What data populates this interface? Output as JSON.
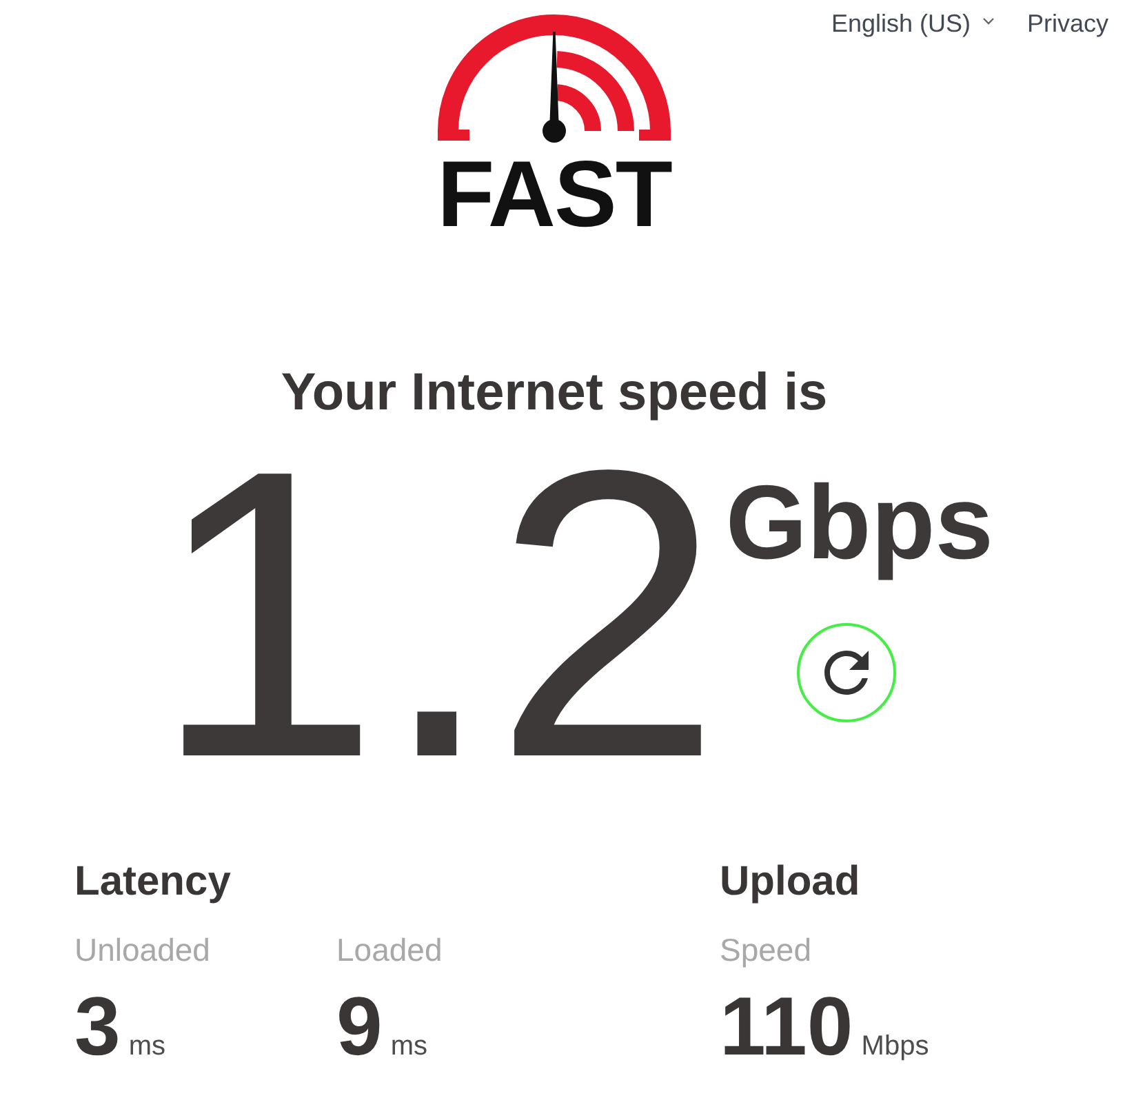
{
  "header": {
    "language_selector": {
      "label": "English (US)"
    },
    "privacy_link": {
      "label": "Privacy"
    }
  },
  "logo": {
    "wordmark": "FAST"
  },
  "speed": {
    "heading": "Your Internet speed is",
    "value": "1.2",
    "unit": "Gbps"
  },
  "stats": [
    {
      "title": "Latency",
      "metrics": [
        {
          "label": "Unloaded",
          "value": "3",
          "unit": "ms"
        },
        {
          "label": "Loaded",
          "value": "9",
          "unit": "ms"
        }
      ]
    },
    {
      "title": "Upload",
      "metrics": [
        {
          "label": "Speed",
          "value": "110",
          "unit": "Mbps"
        }
      ]
    }
  ]
}
